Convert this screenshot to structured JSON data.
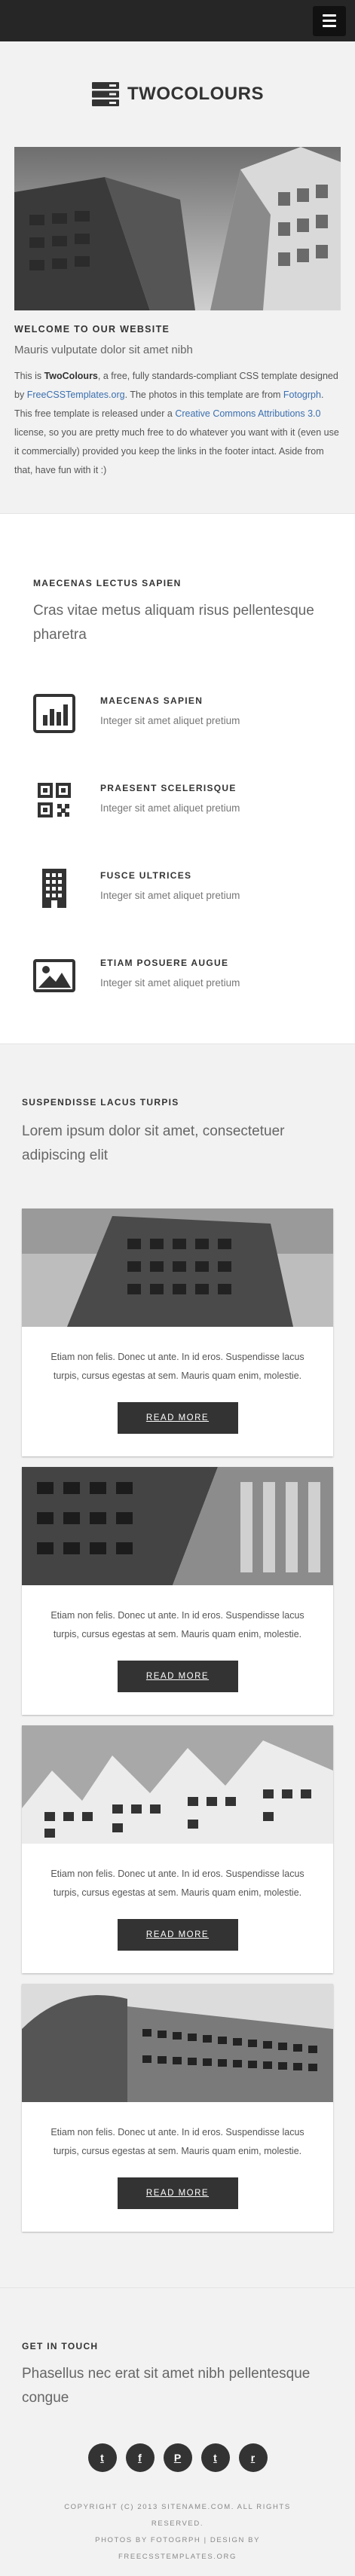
{
  "header": {
    "menu_icon": "hamburger-icon"
  },
  "logo": {
    "title": "TWOCOLOURS",
    "icon": "server-stack-icon"
  },
  "welcome": {
    "heading": "Welcome to our website",
    "subtitle": "Mauris vulputate dolor sit amet nibh",
    "body_1": "This is ",
    "body_brand": "TwoColours",
    "body_2": ", a free, fully standards-compliant CSS template designed by ",
    "link_fct": "FreeCSSTemplates.org",
    "body_3": ". The photos in this template are from ",
    "link_fotogrph": "Fotogrph",
    "body_4": ". This free template is released under a ",
    "link_cc": "Creative Commons Attributions 3.0",
    "body_5": " license, so you are pretty much free to do whatever you want with it (even use it commercially) provided you keep the links in the footer intact. Aside from that, have fun with it :)"
  },
  "features": {
    "heading": "Maecenas lectus sapien",
    "subtitle": "Cras vitae metus aliquam risus pellentesque pharetra",
    "items": [
      {
        "title": "Maecenas sapien",
        "desc": "Integer sit amet aliquet pretium",
        "icon": "bar-chart-icon"
      },
      {
        "title": "Praesent scelerisque",
        "desc": "Integer sit amet aliquet pretium",
        "icon": "qr-code-icon"
      },
      {
        "title": "Fusce ultrices",
        "desc": "Integer sit amet aliquet pretium",
        "icon": "building-icon"
      },
      {
        "title": "Etiam posuere augue",
        "desc": "Integer sit amet aliquet pretium",
        "icon": "picture-icon"
      }
    ]
  },
  "portfolio": {
    "heading": "Suspendisse lacus turpis",
    "subtitle": "Lorem ipsum dolor sit amet, consectetuer adipiscing elit",
    "cards": [
      {
        "text": "Etiam non felis. Donec ut ante. In id eros. Suspendisse lacus turpis, cursus egestas at sem. Mauris quam enim, molestie.",
        "button": "Read More"
      },
      {
        "text": "Etiam non felis. Donec ut ante. In id eros. Suspendisse lacus turpis, cursus egestas at sem. Mauris quam enim, molestie.",
        "button": "Read More"
      },
      {
        "text": "Etiam non felis. Donec ut ante. In id eros. Suspendisse lacus turpis, cursus egestas at sem. Mauris quam enim, molestie.",
        "button": "Read More"
      },
      {
        "text": "Etiam non felis. Donec ut ante. In id eros. Suspendisse lacus turpis, cursus egestas at sem. Mauris quam enim, molestie.",
        "button": "Read More"
      }
    ]
  },
  "contact": {
    "heading": "Get in touch",
    "subtitle": "Phasellus nec erat sit amet nibh pellentesque congue",
    "social": [
      {
        "label": "t",
        "icon": "twitter-icon"
      },
      {
        "label": "f",
        "icon": "facebook-icon"
      },
      {
        "label": "P",
        "icon": "pinterest-icon"
      },
      {
        "label": "t",
        "icon": "tumblr-icon"
      },
      {
        "label": "r",
        "icon": "rss-icon"
      }
    ]
  },
  "footer": {
    "copyright": "Copyright (c) 2013 sitename.com. All rights reserved.",
    "photos_by": "Photos by",
    "photos_link": "Fotogrph",
    "design_by": "Design by",
    "design_link": "FreeCSSTemplates.org"
  }
}
